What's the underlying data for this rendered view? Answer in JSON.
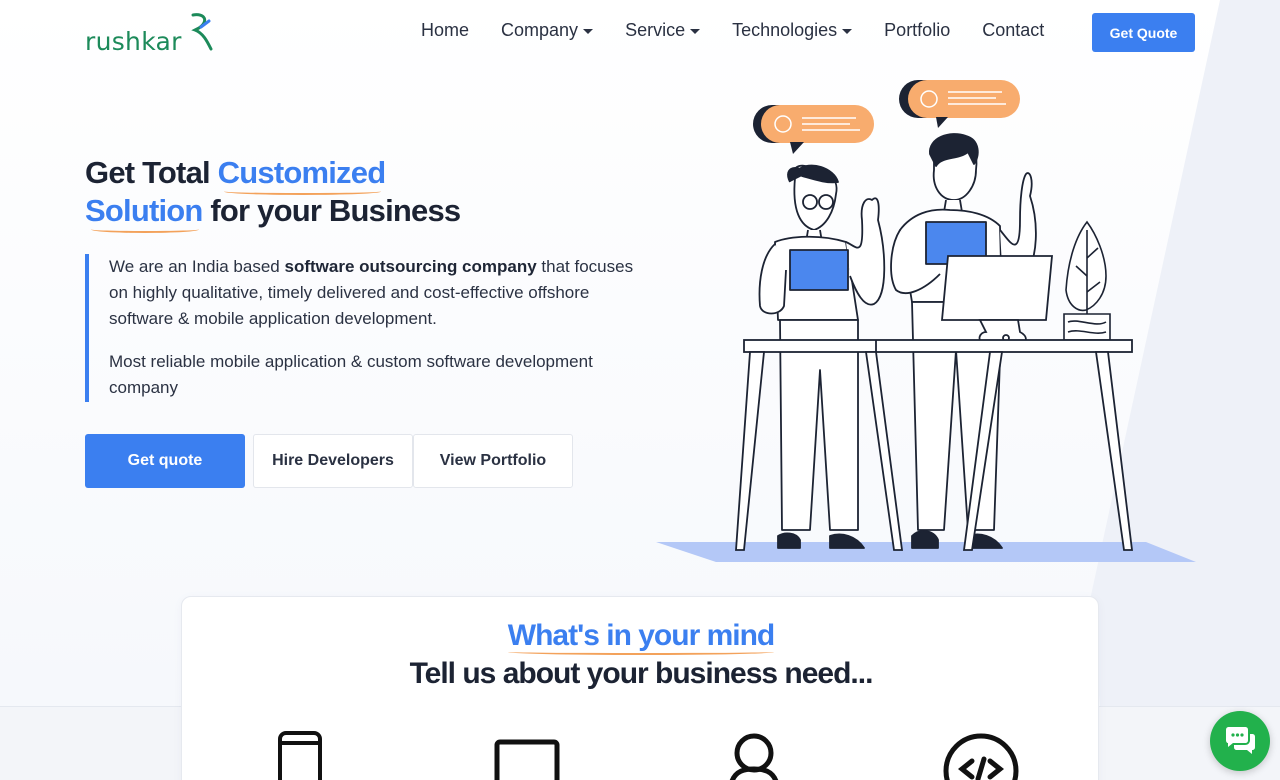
{
  "brand": {
    "name": "rushkar",
    "primary_color": "#3b7ff0",
    "accent_color": "#f3a25b",
    "logo_color": "#1c8a5a"
  },
  "nav": {
    "items": [
      {
        "label": "Home",
        "dropdown": false
      },
      {
        "label": "Company",
        "dropdown": true
      },
      {
        "label": "Service",
        "dropdown": true
      },
      {
        "label": "Technologies",
        "dropdown": true
      },
      {
        "label": "Portfolio",
        "dropdown": false
      },
      {
        "label": "Contact",
        "dropdown": false
      }
    ],
    "cta_label": "Get Quote"
  },
  "hero": {
    "title_part1": "Get Total ",
    "title_highlight1": "Customized",
    "title_highlight2": "Solution",
    "title_part2": " for your Business",
    "desc1_a": "We are an India based ",
    "desc1_bold": "software outsourcing company",
    "desc1_b": " that focuses on highly qualitative, timely delivered and cost-effective offshore software & mobile application development.",
    "desc2": "Most reliable mobile application & custom software development company",
    "buttons": {
      "primary": "Get quote",
      "hire": "Hire Developers",
      "portfolio": "View Portfolio"
    },
    "illustration": "two-developers-at-desk-illustration"
  },
  "mind": {
    "title": "What's in your mind",
    "subtitle": "Tell us about your business need...",
    "icons": [
      "mobile-phone-icon",
      "laptop-icon",
      "user-icon",
      "code-icon"
    ]
  },
  "chat": {
    "icon": "chat-bubbles-icon",
    "color": "#22b14c"
  }
}
